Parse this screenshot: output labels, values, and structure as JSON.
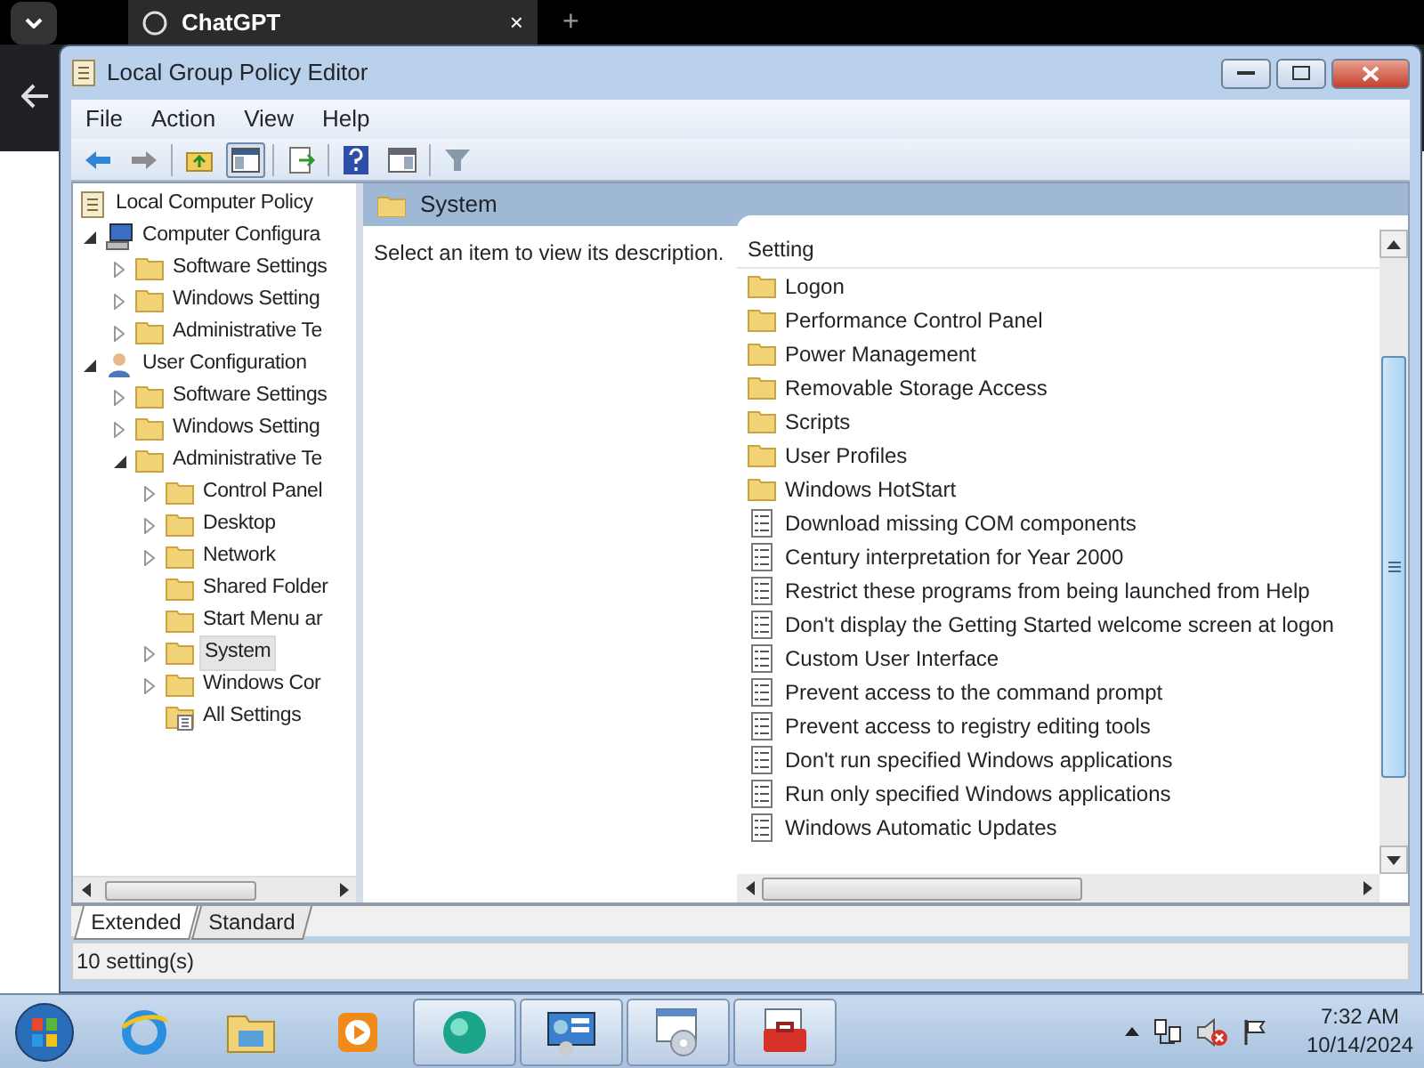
{
  "browser": {
    "tab_title": "ChatGPT",
    "tab_close": "×",
    "new_tab": "+"
  },
  "window": {
    "title": "Local Group Policy Editor"
  },
  "menu": [
    "File",
    "Action",
    "View",
    "Help"
  ],
  "tree": [
    {
      "label": "Local Computer Policy",
      "kind": "policy",
      "selected": false,
      "children": [
        {
          "label": "Computer Configura",
          "kind": "computer",
          "expanded": true,
          "selected": false,
          "children": [
            {
              "label": "Software Settings",
              "kind": "folder",
              "expanded": false,
              "selected": false
            },
            {
              "label": "Windows Setting",
              "kind": "folder",
              "expanded": false,
              "selected": false
            },
            {
              "label": "Administrative Te",
              "kind": "folder",
              "expanded": false,
              "selected": false
            }
          ]
        },
        {
          "label": "User Configuration",
          "kind": "user",
          "expanded": true,
          "selected": false,
          "children": [
            {
              "label": "Software Settings",
              "kind": "folder",
              "expanded": false,
              "selected": false
            },
            {
              "label": "Windows Setting",
              "kind": "folder",
              "expanded": false,
              "selected": false
            },
            {
              "label": "Administrative Te",
              "kind": "folder",
              "expanded": true,
              "selected": false,
              "children": [
                {
                  "label": "Control Panel",
                  "kind": "folder",
                  "expanded": false,
                  "selected": false
                },
                {
                  "label": "Desktop",
                  "kind": "folder",
                  "expanded": false,
                  "selected": false
                },
                {
                  "label": "Network",
                  "kind": "folder",
                  "expanded": false,
                  "selected": false
                },
                {
                  "label": "Shared Folder",
                  "kind": "folder",
                  "selected": false
                },
                {
                  "label": "Start Menu ar",
                  "kind": "folder",
                  "selected": false
                },
                {
                  "label": "System",
                  "kind": "folder",
                  "expanded": false,
                  "selected": true
                },
                {
                  "label": "Windows Cor",
                  "kind": "folder",
                  "expanded": false,
                  "selected": false
                },
                {
                  "label": "All Settings",
                  "kind": "settings",
                  "selected": false
                }
              ]
            }
          ]
        }
      ]
    }
  ],
  "details": {
    "header": "System",
    "description": "Select an item to view its description.",
    "column": "Setting",
    "rows": [
      {
        "kind": "folder",
        "label": "Logon"
      },
      {
        "kind": "folder",
        "label": "Performance Control Panel"
      },
      {
        "kind": "folder",
        "label": "Power Management"
      },
      {
        "kind": "folder",
        "label": "Removable Storage Access"
      },
      {
        "kind": "folder",
        "label": "Scripts"
      },
      {
        "kind": "folder",
        "label": "User Profiles"
      },
      {
        "kind": "folder",
        "label": "Windows HotStart"
      },
      {
        "kind": "setting",
        "label": "Download missing COM components"
      },
      {
        "kind": "setting",
        "label": "Century interpretation for Year 2000"
      },
      {
        "kind": "setting",
        "label": "Restrict these programs from being launched from Help"
      },
      {
        "kind": "setting",
        "label": "Don't display the Getting Started welcome screen at logon"
      },
      {
        "kind": "setting",
        "label": "Custom User Interface"
      },
      {
        "kind": "setting",
        "label": "Prevent access to the command prompt"
      },
      {
        "kind": "setting",
        "label": "Prevent access to registry editing tools"
      },
      {
        "kind": "setting",
        "label": "Don't run specified Windows applications"
      },
      {
        "kind": "setting",
        "label": "Run only specified Windows applications"
      },
      {
        "kind": "setting",
        "label": "Windows Automatic Updates"
      }
    ]
  },
  "view_tabs": [
    {
      "label": "Extended",
      "selected": true
    },
    {
      "label": "Standard",
      "selected": false
    }
  ],
  "status_bar": "10 setting(s)",
  "taskbar": {
    "items": [
      {
        "kind": "ie",
        "running": false
      },
      {
        "kind": "explorer",
        "running": false
      },
      {
        "kind": "media",
        "running": false
      },
      {
        "kind": "globe",
        "running": true
      },
      {
        "kind": "control",
        "running": true
      },
      {
        "kind": "disc",
        "running": true
      },
      {
        "kind": "toolbox",
        "running": true
      }
    ],
    "time": "7:32 AM",
    "date": "10/14/2024"
  }
}
